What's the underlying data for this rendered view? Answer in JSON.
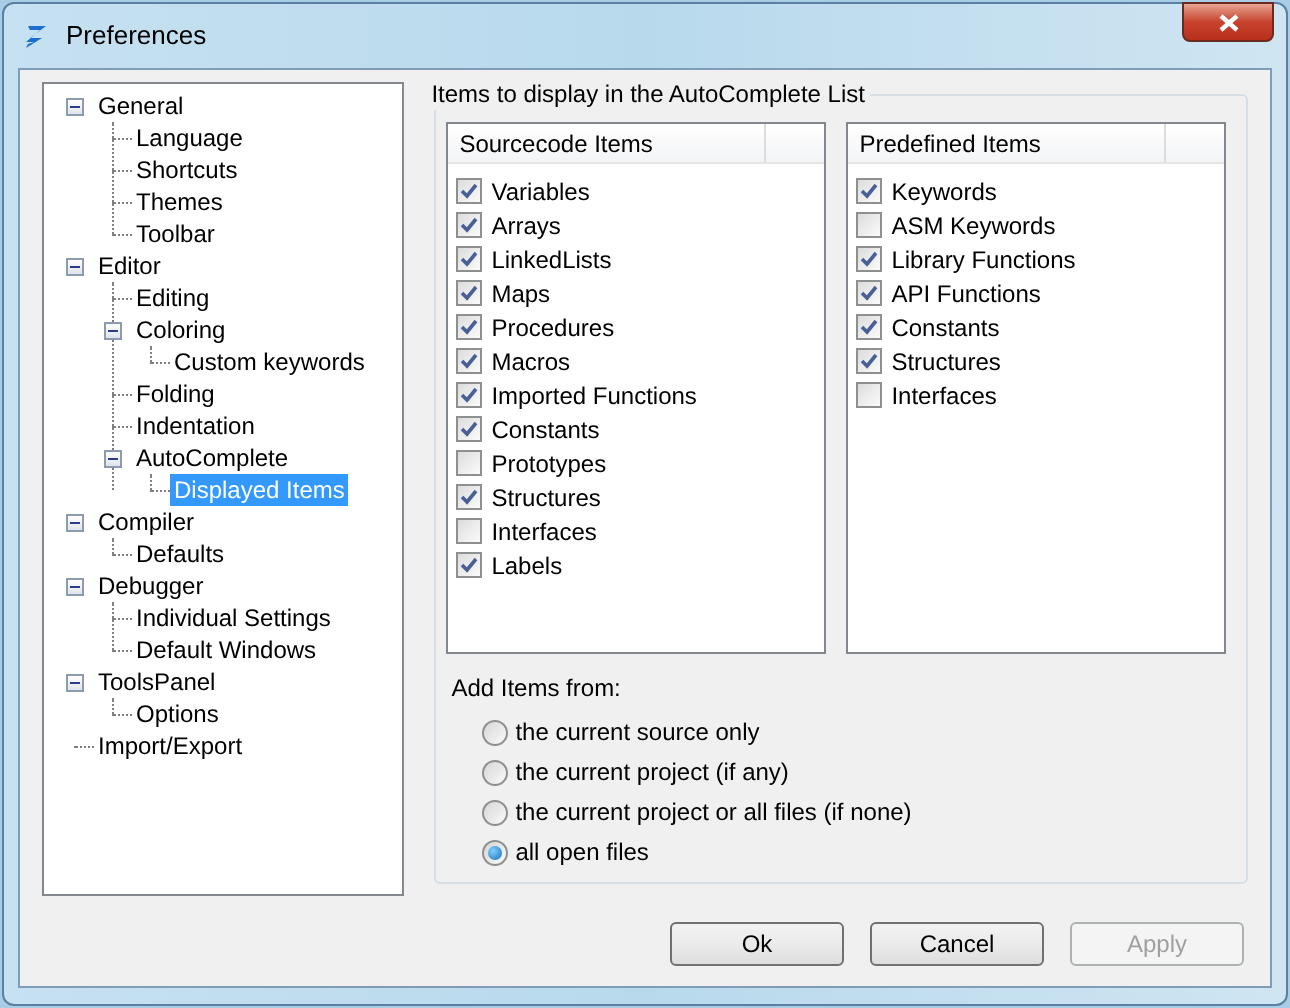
{
  "window": {
    "title": "Preferences"
  },
  "tree": [
    {
      "label": "General",
      "selected": false,
      "expanded": true,
      "children": [
        {
          "label": "Language",
          "selected": false
        },
        {
          "label": "Shortcuts",
          "selected": false
        },
        {
          "label": "Themes",
          "selected": false
        },
        {
          "label": "Toolbar",
          "selected": false
        }
      ]
    },
    {
      "label": "Editor",
      "selected": false,
      "expanded": true,
      "children": [
        {
          "label": "Editing",
          "selected": false
        },
        {
          "label": "Coloring",
          "selected": false,
          "expanded": true,
          "children": [
            {
              "label": "Custom keywords",
              "selected": false
            }
          ]
        },
        {
          "label": "Folding",
          "selected": false
        },
        {
          "label": "Indentation",
          "selected": false
        },
        {
          "label": "AutoComplete",
          "selected": false,
          "expanded": true,
          "children": [
            {
              "label": "Displayed Items",
              "selected": true
            }
          ]
        }
      ]
    },
    {
      "label": "Compiler",
      "selected": false,
      "expanded": true,
      "children": [
        {
          "label": "Defaults",
          "selected": false
        }
      ]
    },
    {
      "label": "Debugger",
      "selected": false,
      "expanded": true,
      "children": [
        {
          "label": "Individual Settings",
          "selected": false
        },
        {
          "label": "Default Windows",
          "selected": false
        }
      ]
    },
    {
      "label": "ToolsPanel",
      "selected": false,
      "expanded": true,
      "children": [
        {
          "label": "Options",
          "selected": false
        }
      ]
    },
    {
      "label": "Import/Export",
      "selected": false
    }
  ],
  "group": {
    "title": "Items to display in the AutoComplete List",
    "lists": [
      {
        "header": "Sourcecode Items",
        "items": [
          {
            "label": "Variables",
            "checked": true
          },
          {
            "label": "Arrays",
            "checked": true
          },
          {
            "label": "LinkedLists",
            "checked": true
          },
          {
            "label": "Maps",
            "checked": true
          },
          {
            "label": "Procedures",
            "checked": true
          },
          {
            "label": "Macros",
            "checked": true
          },
          {
            "label": "Imported Functions",
            "checked": true
          },
          {
            "label": "Constants",
            "checked": true
          },
          {
            "label": "Prototypes",
            "checked": false
          },
          {
            "label": "Structures",
            "checked": true
          },
          {
            "label": "Interfaces",
            "checked": false
          },
          {
            "label": "Labels",
            "checked": true
          }
        ]
      },
      {
        "header": "Predefined Items",
        "items": [
          {
            "label": "Keywords",
            "checked": true
          },
          {
            "label": "ASM Keywords",
            "checked": false
          },
          {
            "label": "Library Functions",
            "checked": true
          },
          {
            "label": "API Functions",
            "checked": true
          },
          {
            "label": "Constants",
            "checked": true
          },
          {
            "label": "Structures",
            "checked": true
          },
          {
            "label": "Interfaces",
            "checked": false
          }
        ]
      }
    ],
    "add_from": {
      "label": "Add Items from:",
      "options": [
        {
          "label": "the current source only",
          "selected": false
        },
        {
          "label": "the current project (if any)",
          "selected": false
        },
        {
          "label": "the current project or all files (if none)",
          "selected": false
        },
        {
          "label": "all open files",
          "selected": true
        }
      ]
    }
  },
  "buttons": [
    {
      "label": "Ok",
      "disabled": false
    },
    {
      "label": "Cancel",
      "disabled": false
    },
    {
      "label": "Apply",
      "disabled": true
    }
  ]
}
